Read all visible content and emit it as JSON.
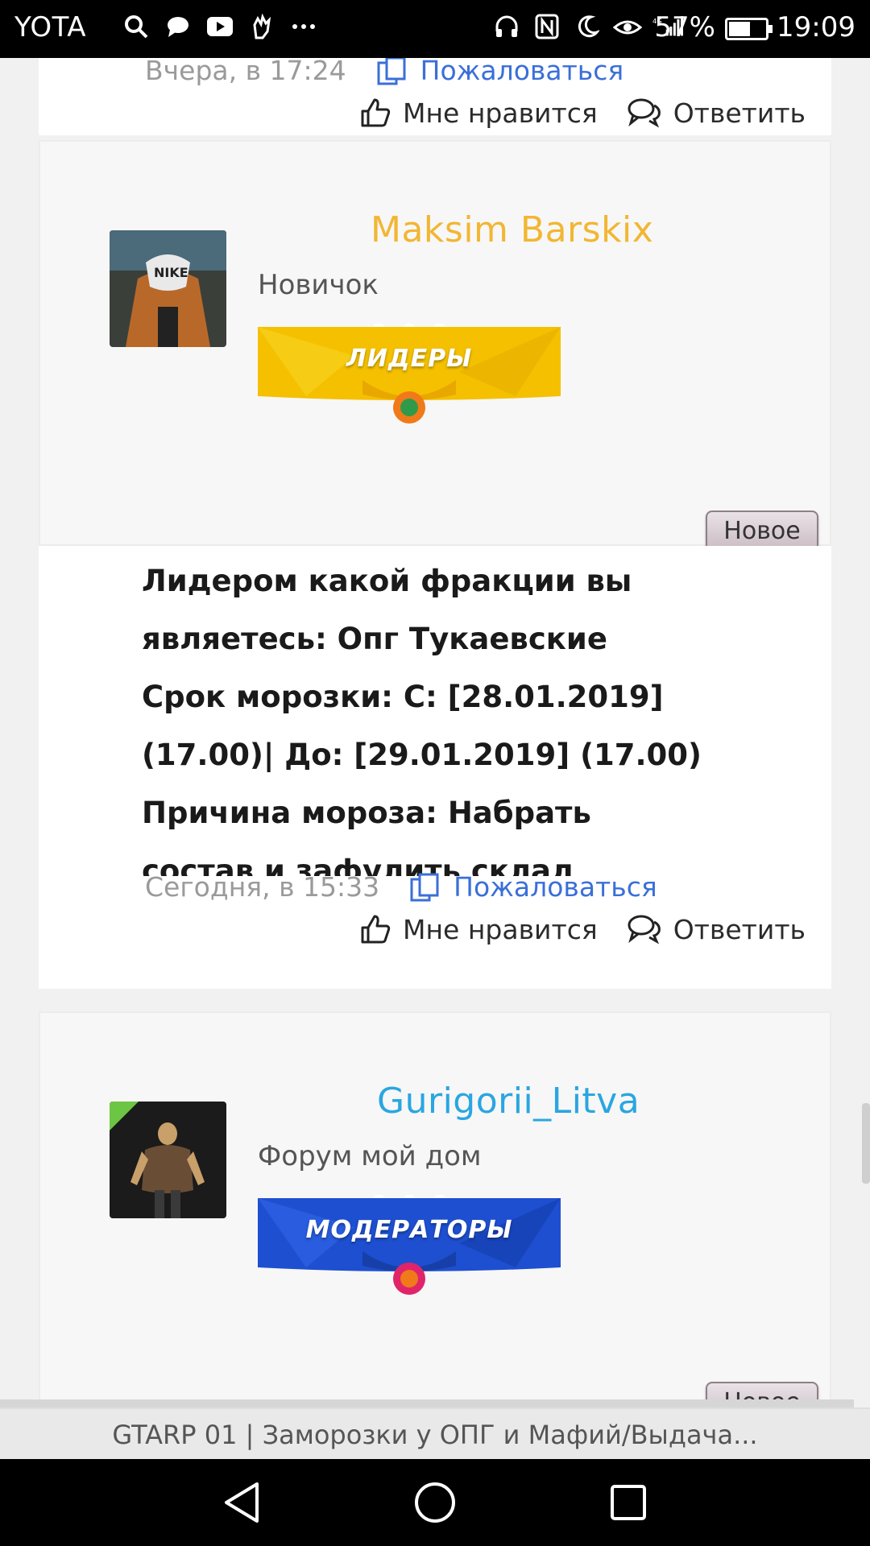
{
  "status_bar": {
    "carrier": "YOTA",
    "battery_percent": "57%",
    "battery_level": 0.57,
    "time": "19:09",
    "left_icons": [
      "search-icon",
      "chat-icon",
      "youtube-icon",
      "hand-icon",
      "more-dots-icon"
    ],
    "right_icons": [
      "headphones-icon",
      "nfc-icon",
      "moon-icon",
      "eye-icon",
      "signal-4g-icon"
    ]
  },
  "prev_post_footer": {
    "date": "Вчера, в 17:24",
    "report_label": "Пожаловаться",
    "like_label": "Мне нравится",
    "reply_label": "Ответить"
  },
  "post1": {
    "username": "Maksim Barskix",
    "username_color": "#f2b632",
    "user_title": "Новичок",
    "banner_label": "ЛИДЕРЫ",
    "banner_color": "#f5c000",
    "new_label": "Новое",
    "text_lines": [
      "Лидером какой фракции вы",
      "являетесь: Опг Тукаевские",
      "Срок морозки: С: [28.01.2019]",
      "(17.00)| До: [29.01.2019] (17.00)",
      "Причина мороза: Набрать",
      "состав и зафулить склад"
    ],
    "date": "Сегодня, в 15:33",
    "report_label": "Пожаловаться",
    "like_label": "Мне нравится",
    "reply_label": "Ответить"
  },
  "post2": {
    "username": "Gurigorii_Litva",
    "username_color": "#2aa6e0",
    "user_title": "Форум мой дом",
    "banner_label": "МОДЕРАТОРЫ",
    "banner_color": "#1e4fd0",
    "new_label": "Новое"
  },
  "page_title": "GTARP 01 | Заморозки у ОПГ и Мафий/Выдача..."
}
